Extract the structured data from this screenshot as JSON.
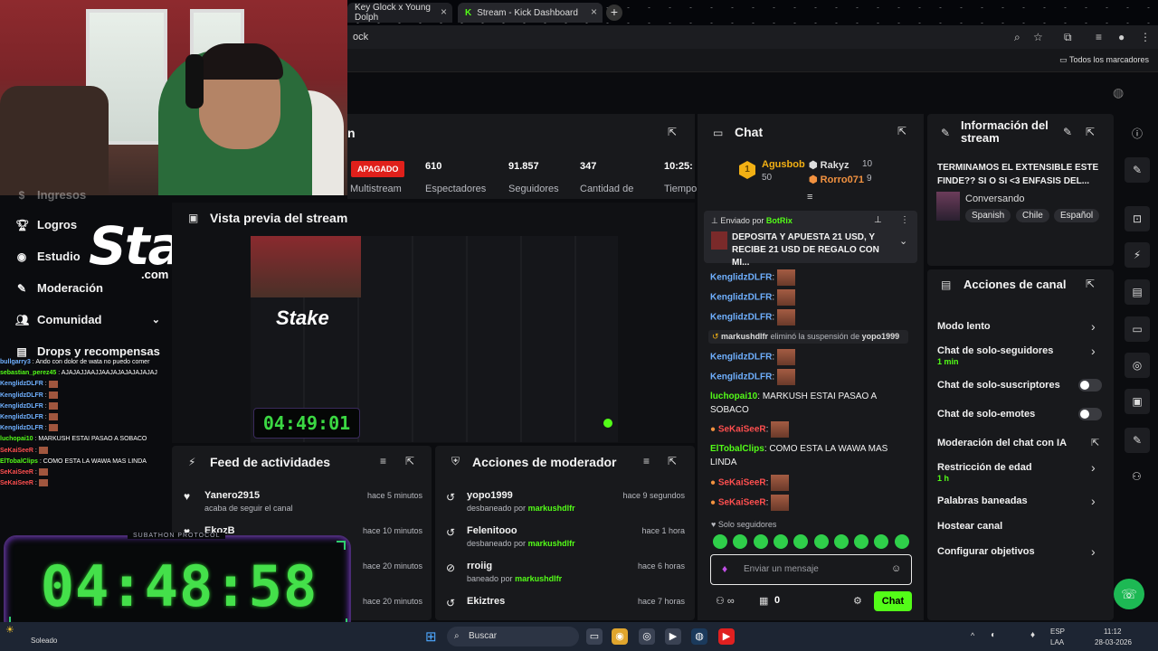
{
  "browser": {
    "tabs": [
      {
        "label": "Key Glock x Young Dolph"
      },
      {
        "label": "Stream - Kick Dashboard"
      }
    ],
    "bookmarks_all": "Todos los marcadores"
  },
  "sidebar": {
    "items": [
      {
        "label": "Ingresos"
      },
      {
        "label": "Logros"
      },
      {
        "label": "Estudio"
      },
      {
        "label": "Moderación"
      },
      {
        "label": "Comunidad"
      },
      {
        "label": "Drops y recompensas"
      }
    ]
  },
  "overlay": {
    "stake": "Stake",
    "stake_com": ".com",
    "chat": [
      {
        "user": "bullgarry3",
        "text": "Ando con dolor de wata no puedo comer",
        "color": "#6fb0ff"
      },
      {
        "user": "sebastian_perez45",
        "text": "AJAJAJJAAJJAAJAJAJAJAJAJAJ",
        "color": "#53fc18"
      },
      {
        "user": "KenglidzDLFR",
        "text": "",
        "color": "#6fb0ff"
      },
      {
        "user": "KenglidzDLFR",
        "text": "",
        "color": "#6fb0ff"
      },
      {
        "user": "KenglidzDLFR",
        "text": "",
        "color": "#6fb0ff"
      },
      {
        "user": "KenglidzDLFR",
        "text": "",
        "color": "#6fb0ff"
      },
      {
        "user": "KenglidzDLFR",
        "text": "",
        "color": "#6fb0ff"
      },
      {
        "user": "luchopai10",
        "text": "MARKUSH ESTAI PASAO A SOBACO",
        "color": "#53fc18"
      },
      {
        "user": "SeKaiSeeR",
        "text": "",
        "color": "#ff4f4f"
      },
      {
        "user": "ElTobalClips",
        "text": "COMO ESTA LA WAWA MAS LINDA",
        "color": "#53fc18"
      },
      {
        "user": "SeKaiSeeR",
        "text": "",
        "color": "#ff4f4f"
      },
      {
        "user": "SeKaiSeeR",
        "text": "",
        "color": "#ff4f4f"
      }
    ],
    "timer_label": "SUBATHON PROTOCOL",
    "timer": "04:48:58",
    "weather": "Soleado"
  },
  "stats": {
    "title": "n",
    "live": "APAGADO",
    "live_sub": "Multistream",
    "items": [
      {
        "value": "610",
        "label": "Espectadores"
      },
      {
        "value": "91.857",
        "label": "Seguidores"
      },
      {
        "value": "347",
        "label": "Cantidad de"
      },
      {
        "value": "10:25:",
        "label": "Tiempo"
      }
    ]
  },
  "preview": {
    "title": "Vista previa del stream",
    "timer": "04:49:01"
  },
  "feed": {
    "title": "Feed de actividades",
    "items": [
      {
        "name": "Yanero2915",
        "sub": "acaba de seguir el canal",
        "time": "hace 5 minutos"
      },
      {
        "name": "EkozB",
        "sub": "",
        "time": "hace 10 minutos"
      },
      {
        "name": "",
        "sub": "",
        "time": "hace 20 minutos"
      },
      {
        "name": "",
        "sub": "",
        "time": "hace 20 minutos"
      }
    ]
  },
  "modactions": {
    "title": "Acciones de moderador",
    "items": [
      {
        "name": "yopo1999",
        "sub": "desbaneado por",
        "mod": "markushdlfr",
        "time": "hace 9 segundos"
      },
      {
        "name": "Felenitooo",
        "sub": "desbaneado por",
        "mod": "markushdlfr",
        "time": "hace 1 hora"
      },
      {
        "name": "rroiig",
        "sub": "baneado por",
        "mod": "markushdlfr",
        "time": "hace 6 horas"
      },
      {
        "name": "Ekiztres",
        "sub": "",
        "mod": "",
        "time": "hace 7 horas"
      }
    ]
  },
  "chat": {
    "title": "Chat",
    "leaders": [
      {
        "name": "Agusbob",
        "value": "50"
      },
      {
        "name": "Rakyz",
        "value": "10"
      },
      {
        "name": "Rorro071",
        "value": "9"
      }
    ],
    "pinned_by": "Enviado por",
    "pinned_user": "BotRix",
    "pinned_text": "DEPOSITA Y APUESTA 21 USD, Y RECIBE 21 USD DE REGALO CON MI...",
    "messages": [
      {
        "user": "KenglidzDLFR",
        "text": "",
        "color": "#6fb0ff",
        "emote": true
      },
      {
        "user": "KenglidzDLFR",
        "text": "",
        "color": "#6fb0ff",
        "emote": true
      },
      {
        "user": "KenglidzDLFR",
        "text": "",
        "color": "#6fb0ff",
        "emote": true
      },
      {
        "user": "markushdlfr",
        "text": "eliminó la suspensión de",
        "target": "yopo1999",
        "color": "#b7b9bf",
        "system": true
      },
      {
        "user": "KenglidzDLFR",
        "text": "",
        "color": "#6fb0ff",
        "emote": true
      },
      {
        "user": "KenglidzDLFR",
        "text": "",
        "color": "#6fb0ff",
        "emote": true
      },
      {
        "user": "luchopai10",
        "text": "MARKUSH ESTAI PASAO A SOBACO",
        "color": "#53fc18"
      },
      {
        "user": "SeKaiSeeR",
        "text": "",
        "color": "#ff4f4f",
        "emote": true
      },
      {
        "user": "ElTobalClips",
        "text": "COMO ESTA LA WAWA MAS LINDA",
        "color": "#53fc18"
      },
      {
        "user": "SeKaiSeeR",
        "text": "",
        "color": "#ff4f4f",
        "emote": true
      },
      {
        "user": "SeKaiSeeR",
        "text": "",
        "color": "#ff4f4f",
        "emote": true
      }
    ],
    "followers_only": "Solo seguidores",
    "placeholder": "Enviar un mensaje",
    "count": "0",
    "send": "Chat"
  },
  "info": {
    "title": "Información del stream",
    "stream_title": "TERMINAMOS EL EXTENSIBLE ESTE FINDE?? SI O SI <3 ENFASIS DEL...",
    "category": "Conversando",
    "tags": [
      "Spanish",
      "Chile",
      "Español"
    ]
  },
  "channel": {
    "title": "Acciones de canal",
    "items": [
      {
        "label": "Modo lento",
        "sub": "",
        "control": "chevron"
      },
      {
        "label": "Chat de solo-seguidores",
        "sub": "1 min",
        "control": "chevron"
      },
      {
        "label": "Chat de solo-suscriptores",
        "sub": "",
        "control": "toggle"
      },
      {
        "label": "Chat de solo-emotes",
        "sub": "",
        "control": "toggle"
      },
      {
        "label": "Moderación del chat con IA",
        "sub": "",
        "control": "external"
      },
      {
        "label": "Restricción de edad",
        "sub": "1 h",
        "control": "chevron"
      },
      {
        "label": "Palabras baneadas",
        "sub": "",
        "control": "chevron"
      },
      {
        "label": "Hostear canal",
        "sub": "",
        "control": "none"
      },
      {
        "label": "Configurar objetivos",
        "sub": "",
        "control": "chevron"
      }
    ]
  },
  "taskbar": {
    "search": "Buscar",
    "lang": "ESP",
    "lang2": "LAA",
    "time": "11:12",
    "date": "28-03-2026"
  }
}
